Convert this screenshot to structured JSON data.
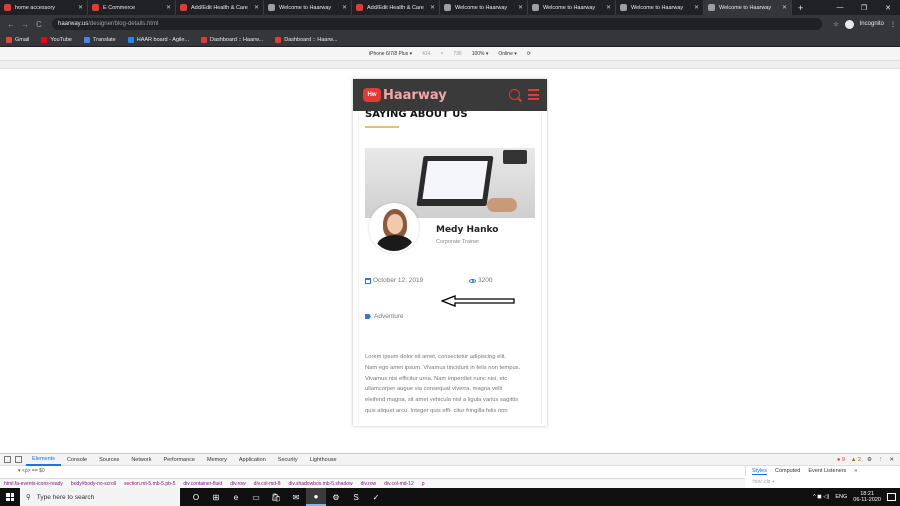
{
  "browser": {
    "tabs": [
      {
        "title": "home accessory",
        "favicon_color": "#e53935"
      },
      {
        "title": "E Commerce",
        "favicon_color": "#e53935"
      },
      {
        "title": "Add/Edit Health & Care",
        "favicon_color": "#e53935"
      },
      {
        "title": "Welcome to Haarway",
        "favicon_color": "#9aa0a6"
      },
      {
        "title": "Add/Edit Health & Care",
        "favicon_color": "#e53935"
      },
      {
        "title": "Welcome to Haarway",
        "favicon_color": "#9aa0a6"
      },
      {
        "title": "Welcome to Haarway",
        "favicon_color": "#9aa0a6"
      },
      {
        "title": "Welcome to Haarway",
        "favicon_color": "#9aa0a6"
      },
      {
        "title": "Welcome to Haarway",
        "favicon_color": "#9aa0a6",
        "active": true
      }
    ],
    "new_tab": "+",
    "window_controls": {
      "minimize": "—",
      "maximize": "❐",
      "close": "✕"
    },
    "nav": {
      "back": "←",
      "forward": "→",
      "reload": "C"
    },
    "url_host": "haarway.us",
    "url_path": "/designer/blog-details.html",
    "star": "☆",
    "profile_label": "Incognito",
    "menu": "⋮",
    "bookmarks": [
      {
        "label": "Gmail",
        "color": "#ea4335"
      },
      {
        "label": "YouTube",
        "color": "#ff0000"
      },
      {
        "label": "Translate",
        "color": "#4285f4"
      },
      {
        "label": "HAAR board - Agile...",
        "color": "#2684ff"
      },
      {
        "label": "Dashboard :: Haarw...",
        "color": "#e53935"
      },
      {
        "label": "Dashboard :: Haarw...",
        "color": "#e53935"
      }
    ]
  },
  "device_toolbar": {
    "device": "iPhone 6/7/8 Plus ▾",
    "width": "414",
    "x": "×",
    "height": "736",
    "zoom": "100% ▾",
    "network": "Online ▾"
  },
  "page": {
    "logo_badge": "Hw",
    "logo_text": "Haarway",
    "section_title": "SAYING ABOUT US",
    "author_name": "Medy Hanko",
    "author_role": "Corporate Trainer",
    "date": "October 12, 2019",
    "views": "3200",
    "tag": "Adventure",
    "body_lines": [
      "Lorem ipsum dolor sit amet, consectetur adipiscing elit.",
      "Nam ego amet ipsum. Vivamus tincidunt in felis non tempus.",
      "Vivamus nisi efficitur urna. Nam imperdiet nunc nisi, etc",
      "ullamcorper augue via consequat viverra, magna velit",
      "eleifend magna, sit amet vehicula nisl a ligula varius sagittis",
      "quis aliquet arcu. Integer quis effi- citur fringilla felis non"
    ]
  },
  "devtools": {
    "tabs": [
      "Elements",
      "Console",
      "Sources",
      "Network",
      "Performance",
      "Memory",
      "Application",
      "Security",
      "Lighthouse"
    ],
    "active_tab": "Elements",
    "errors": "● 9",
    "warnings": "▲ 2",
    "settings": "⚙",
    "more": "⋮",
    "close": "✕",
    "source_line": "▾ <p> == $0",
    "style_tabs": [
      "Styles",
      "Computed",
      "Event Listeners",
      "»"
    ],
    "breadcrumbs": [
      "html.fa-events-icons-ready",
      "body#body-no-scroll",
      "section.mt-5.mb-5.pb-5",
      "div.container-fluid",
      "div.row",
      "div.col-md-8",
      "div.shadowbox.mb-5.shadow",
      "div.row",
      "div.col-md-12",
      "p"
    ],
    "filter": ":hov .cls +"
  },
  "taskbar": {
    "search_placeholder": "Type here to search",
    "apps": [
      "O",
      "⊞",
      "e",
      "▭",
      "🛍",
      "✉",
      "●",
      "⚙",
      "S",
      "✓"
    ],
    "active_app_index": 6,
    "tray_icons": "^ ◼ ◁) ",
    "lang": "ENG",
    "time": "18:21",
    "date": "06-11-2020"
  }
}
